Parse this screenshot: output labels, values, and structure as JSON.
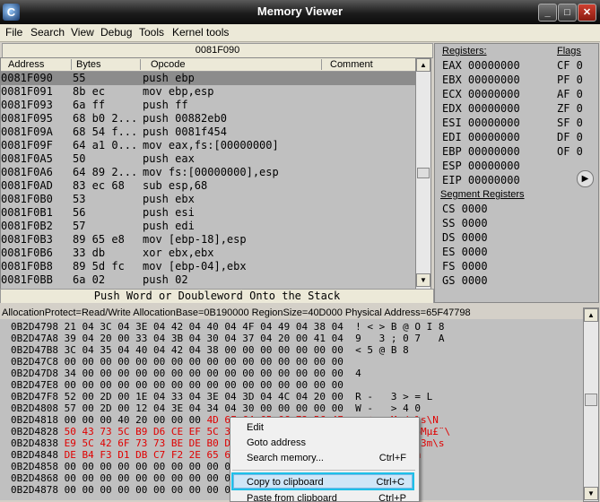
{
  "window": {
    "title": "Memory Viewer",
    "icon": "cheat-engine-icon",
    "min": "minimize-icon",
    "max": "maximize-icon",
    "close": "close-icon",
    "icon_glyph": "C"
  },
  "menu": [
    "File",
    "Search",
    "View",
    "Debug",
    "Tools",
    "Kernel tools"
  ],
  "address_bar": "0081F090",
  "disasm": {
    "headers": [
      "Address",
      "Bytes",
      "Opcode",
      "Comment"
    ],
    "rows": [
      {
        "addr": "0081F090",
        "bytes": "55",
        "op": "push ebp"
      },
      {
        "addr": "0081F091",
        "bytes": "8b ec",
        "op": "mov ebp,esp"
      },
      {
        "addr": "0081F093",
        "bytes": "6a ff",
        "op": "push ff"
      },
      {
        "addr": "0081F095",
        "bytes": "68 b0 2...",
        "op": "push 00882eb0"
      },
      {
        "addr": "0081F09A",
        "bytes": "68 54 f...",
        "op": "push 0081f454"
      },
      {
        "addr": "0081F09F",
        "bytes": "64 a1 0...",
        "op": "mov eax,fs:[00000000]"
      },
      {
        "addr": "0081F0A5",
        "bytes": "50",
        "op": "push eax"
      },
      {
        "addr": "0081F0A6",
        "bytes": "64 89 2...",
        "op": "mov fs:[00000000],esp"
      },
      {
        "addr": "0081F0AD",
        "bytes": "83 ec 68",
        "op": "sub esp,68"
      },
      {
        "addr": "0081F0B0",
        "bytes": "53",
        "op": "push ebx"
      },
      {
        "addr": "0081F0B1",
        "bytes": "56",
        "op": "push esi"
      },
      {
        "addr": "0081F0B2",
        "bytes": "57",
        "op": "push edi"
      },
      {
        "addr": "0081F0B3",
        "bytes": "89 65 e8",
        "op": "mov [ebp-18],esp"
      },
      {
        "addr": "0081F0B6",
        "bytes": "33 db",
        "op": "xor ebx,ebx"
      },
      {
        "addr": "0081F0B8",
        "bytes": "89 5d fc",
        "op": "mov [ebp-04],ebx"
      },
      {
        "addr": "0081F0BB",
        "bytes": "6a 02",
        "op": "push 02"
      }
    ]
  },
  "status_line": "Push Word or Doubleword Onto the Stack",
  "registers": {
    "label": "Registers:",
    "flags_label": "Flags",
    "gp": [
      "EAX 00000000",
      "EBX 00000000",
      "ECX 00000000",
      "EDX 00000000",
      "ESI 00000000",
      "EDI 00000000",
      "EBP 00000000",
      "ESP 00000000",
      "EIP 00000000"
    ],
    "flags": [
      "CF 0",
      "PF 0",
      "AF 0",
      "ZF 0",
      "SF 0",
      "DF 0",
      "OF 0"
    ],
    "seg_label": "Segment Registers",
    "seg": [
      "CS 0000",
      "SS 0000",
      "DS 0000",
      "ES 0000",
      "FS 0000",
      "GS 0000"
    ],
    "arrow": "chevron-right-icon"
  },
  "hex": {
    "info": "AllocationProtect=Read/Write  AllocationBase=0B190000  RegionSize=40D000  Physical Address=65F47798",
    "rows": [
      {
        "a": "0B2D4798",
        "b": "21 04 3C 04 3E 04 42 04 40 04 4F 04 49 04 38 04",
        "t": "! < > B @ O I 8",
        "red": ""
      },
      {
        "a": "0B2D47A8",
        "b": "39 04 20 00 33 04 3B 04 30 04 37 04 20 00 41 04",
        "t": "9   3 ; 0 7   A",
        "red": ""
      },
      {
        "a": "0B2D47B8",
        "b": "3C 04 35 04 40 04 42 04 38 00 00 00 00 00 00 00",
        "t": "< 5 @ B 8",
        "red": ""
      },
      {
        "a": "0B2D47C8",
        "b": "00 00 00 00 00 00 00 00 00 00 00 00 00 00 00 00",
        "t": "",
        "red": ""
      },
      {
        "a": "0B2D47D8",
        "b": "34 00 00 00 00 00 00 00 00 00 00 00 00 00 00 00",
        "t": "4",
        "red": ""
      },
      {
        "a": "0B2D47E8",
        "b": "00 00 00 00 00 00 00 00 00 00 00 00 00 00 00 00",
        "t": "",
        "red": ""
      },
      {
        "a": "0B2D47F8",
        "b": "52 00 2D 00 1E 04 33 04 3E 04 3D 04 4C 04 20 00",
        "t": "R -   3 > = L",
        "red": ""
      },
      {
        "a": "0B2D4808",
        "b": "57 00 2D 00 12 04 3E 04 34 04 30 00 00 00 00 00",
        "t": "W -   > 4 0",
        "red": ""
      },
      {
        "a": "0B2D4818",
        "b": "00 00 00 40 20 00 00 00",
        "t": "",
        "red": "4D 6F 64 65 6C 73 5C 4E    @   Models\\N"
      },
      {
        "a": "0B2D4828",
        "b": "",
        "t": "",
        "red": "50 43 73 5C B9 D6 CE EF 5C 30 36 4D B5 A3 A8 5C  PCs\\¹ГÎï\\06Mµ£¨\\"
      },
      {
        "a": "0B2D4838",
        "b": "",
        "t": "",
        "red": "E9 5C 42 6F 73 73 BE DE B0 D8 5C 33 6D 5C 73 00  é\\BossSpec\\3m\\s"
      },
      {
        "a": "0B2D4848",
        "b": "",
        "t": "",
        "red": "DE B4 F3 D1 DB C7 F2 2E 65 63 6D 00 00 00 00 00  Þ´óÑÛÇò.ecm"
      },
      {
        "a": "0B2D4858",
        "b": "00 00 00 00 00 00 00 00 00 00 00 00 00 00 00 00",
        "t": "",
        "red": ""
      },
      {
        "a": "0B2D4868",
        "b": "00 00 00 00 00 00 00 00 00 00 00 00 00 00 00 00",
        "t": "",
        "red": ""
      },
      {
        "a": "0B2D4878",
        "b": "00 00 00 00 00 00 00 00 00 00 00 00 00 00 00 00",
        "t": "",
        "red": ""
      }
    ]
  },
  "context_menu": {
    "items": [
      {
        "label": "Edit",
        "shortcut": ""
      },
      {
        "label": "Goto address",
        "shortcut": ""
      },
      {
        "label": "Search memory...",
        "shortcut": "Ctrl+F"
      },
      {
        "label": "Copy to clipboard",
        "shortcut": "Ctrl+C"
      },
      {
        "label": "Paste from clipboard",
        "shortcut": "Ctrl+P"
      }
    ]
  },
  "scroll": {
    "up": "▲",
    "down": "▼"
  }
}
